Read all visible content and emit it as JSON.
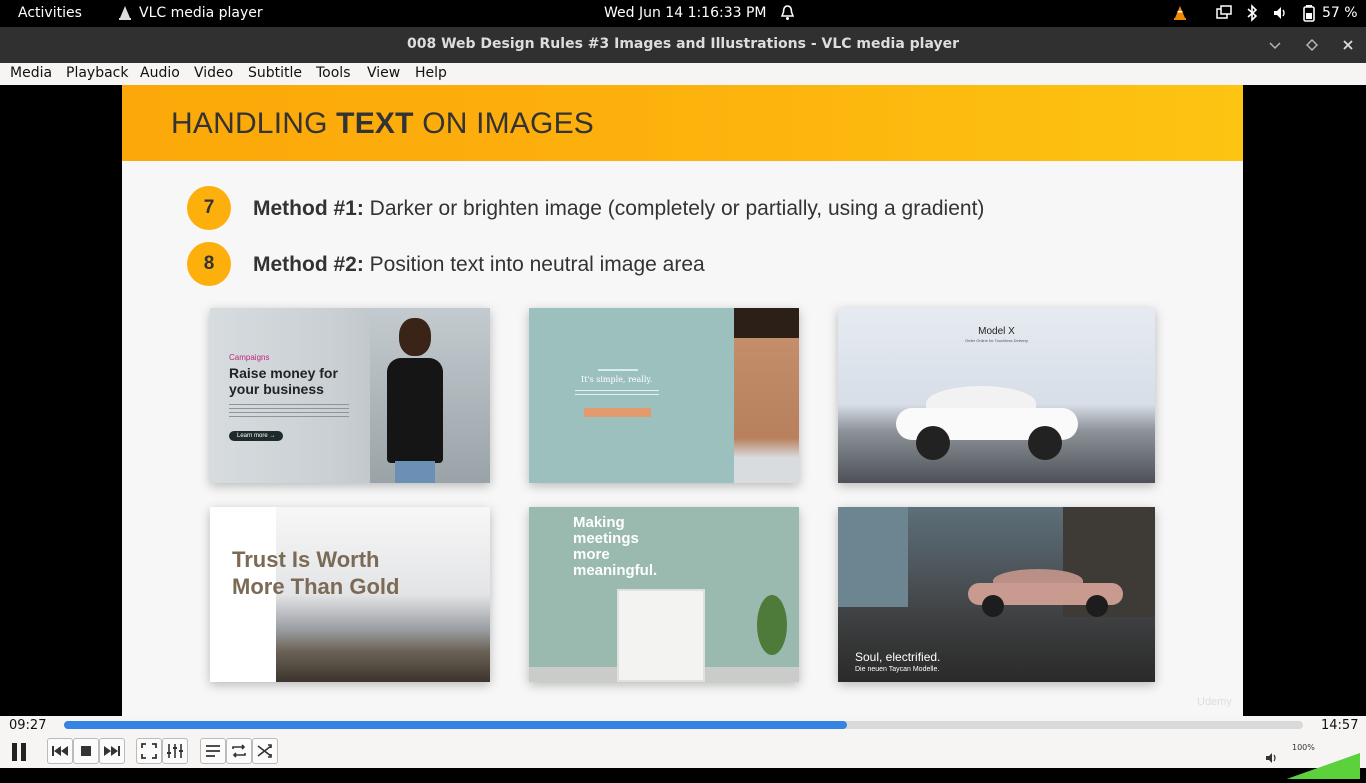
{
  "topbar": {
    "activities": "Activities",
    "app_name": "VLC media player",
    "datetime": "Wed Jun 14   1:16:33 PM",
    "battery": "57 %"
  },
  "window": {
    "title": "008 Web Design Rules #3 Images and Illustrations - VLC media player"
  },
  "menu": [
    "Media",
    "Playback",
    "Audio",
    "Video",
    "Subtitle",
    "Tools",
    "View",
    "Help"
  ],
  "slide": {
    "heading_pre": "HANDLING ",
    "heading_bold": "TEXT",
    "heading_post": " ON IMAGES",
    "methods": [
      {
        "number": "7",
        "label": "Method #1:",
        "text": " Darker or brighten image (completely or partially, using a gradient)"
      },
      {
        "number": "8",
        "label": "Method #2:",
        "text": " Position text into neutral image area"
      }
    ],
    "thumbs": {
      "t1": {
        "tag": "Campaigns",
        "title1": "Raise money for",
        "title2": "your business",
        "button": "Learn more →"
      },
      "t2": {
        "title": "It's simple, really."
      },
      "t3": {
        "title": "Model X",
        "subtitle": "Order Online for Touchless Delivery"
      },
      "t4": {
        "line1": "Trust Is Worth",
        "line2": "More Than Gold"
      },
      "t5": {
        "line1": "Making",
        "line2": "meetings",
        "line3": "more",
        "line4": "meaningful."
      },
      "t6": {
        "title": "Soul, electrified.",
        "subtitle": "Die neuen Taycan Modelle."
      }
    },
    "watermark": "Udemy"
  },
  "player": {
    "elapsed": "09:27",
    "total": "14:57",
    "progress": 0.632,
    "volume_label": "100%",
    "volume": 1.0
  },
  "colors": {
    "accent": "#fdb00c",
    "progress": "#3584e4",
    "volume": "#5bd13b"
  }
}
